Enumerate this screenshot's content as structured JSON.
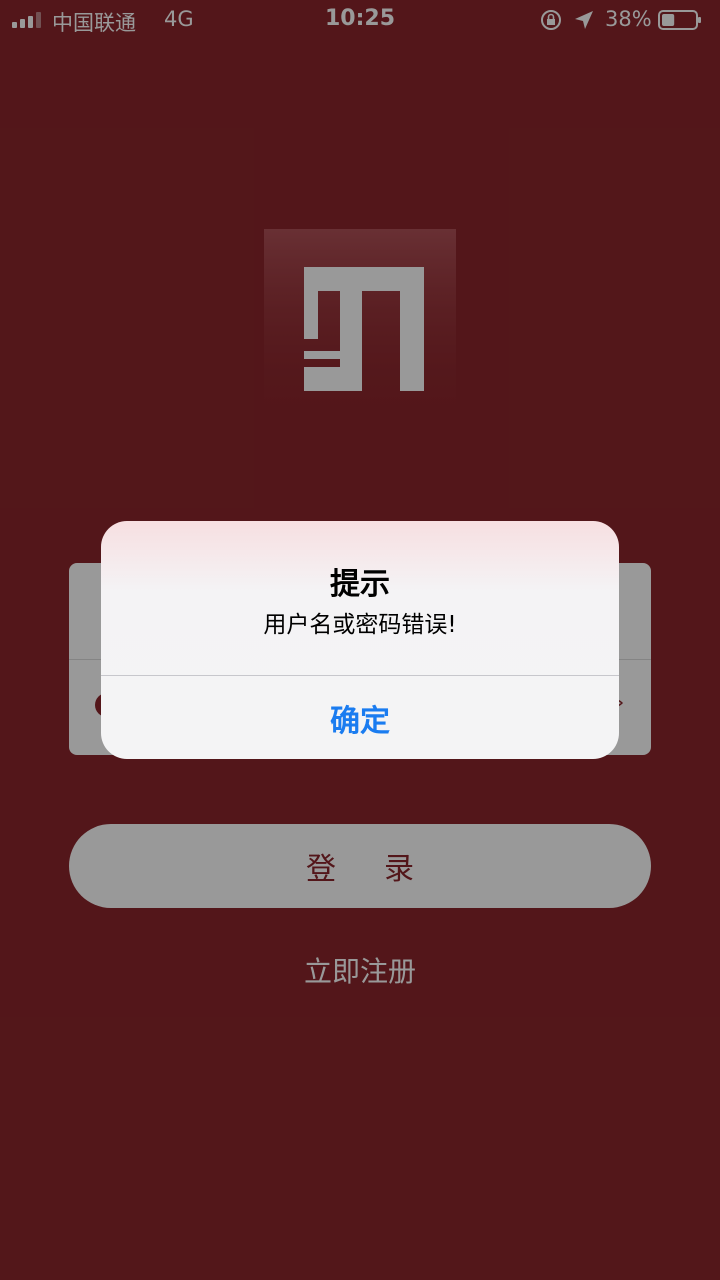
{
  "status_bar": {
    "carrier": "中国联通",
    "network": "4G",
    "time": "10:25",
    "battery_percent": "38%",
    "battery_level": 0.38,
    "icons": [
      "signal-icon",
      "orientation-lock-icon",
      "location-arrow-icon",
      "battery-icon"
    ]
  },
  "login": {
    "login_button": "登录",
    "register_link": "立即注册"
  },
  "alert": {
    "title": "提示",
    "message": "用户名或密码错误!",
    "confirm_button": "确定"
  },
  "colors": {
    "background": "#8b262c",
    "alert_button": "#1a7cf0"
  }
}
